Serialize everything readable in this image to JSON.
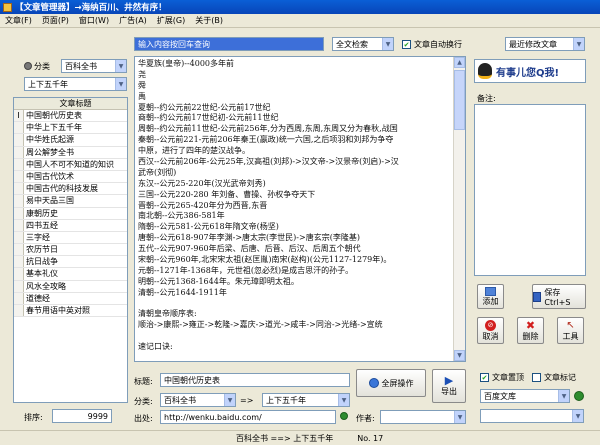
{
  "window": {
    "title": "【文章管理器】→海纳百川、井然有序！"
  },
  "menu": [
    "文章(F)",
    "页面(P)",
    "窗口(W)",
    "广告(A)",
    "扩展(G)",
    "关于(B)"
  ],
  "search": {
    "value": "输入内容按回车查询",
    "mode": "全文检索",
    "auto_wrap_label": "文章自动换行",
    "auto_wrap_checked": true,
    "sort": "最近修改文章"
  },
  "left": {
    "category_label": "分类",
    "category_value": "百科全书",
    "subcategory_value": "上下五千年",
    "list_header": "文章标题",
    "items": [
      "中国朝代历史表",
      "中华上下五千年",
      "中华姓氏起源",
      "周公解梦全书",
      "中国人不可不知道的知识",
      "中国古代饮术",
      "中国古代的科技发展",
      "易中天品三国",
      "康朝历史",
      "四书五经",
      "三字经",
      "农历节日",
      "抗日战争",
      "基本礼仪",
      "风水全攻略",
      "道德经",
      "春节用语中英对照"
    ],
    "selected_index": 0
  },
  "editor": {
    "lines": [
      "华夏族(皇帝)--4000多年前",
      "尧",
      "舜",
      "禹",
      "夏朝--约公元前22世纪-公元前17世纪",
      "商朝--约公元前17世纪初-公元前11世纪",
      "周朝--约公元前11世纪-公元前256年,分为西周,东周,东周又分为春秋,战国",
      "秦朝--公元前221-元前206年秦王(嬴政)统一六国,之后项羽和刘邦为争夺",
      "中原，进行了四年的楚汉战争。",
      "西汉--公元前206年-公元25年,汉高祖(刘邦)->汉文帝->汉景帝(刘启)->汉",
      "武帝(刘彻)",
      "东汉--公元25-220年(汉光武帝刘秀)",
      "三国--公元220-280 年刘备、曹操、孙权争夺天下",
      "晋朝--公元265-420年分为西晋,东晋",
      "南北朝--公元386-581年",
      "隋朝--公元581-公元618年隋文帝(杨坚)",
      "唐朝--公元618-907年李渊->唐太宗(李世民)->唐玄宗(李隆基)",
      "五代--公元907-960年后梁、后唐、后晋、后汉、后周五个朝代",
      "宋朝--公元960年,北宋宋太祖(赵匡胤)南宋(赵构)(公元1127-1279年)。",
      "元朝--1271年-1368年，元世祖(忽必烈)是成吉思汗的孙子。",
      "明朝--公元1368-1644年。朱元璋即明太祖。",
      "清朝--公元1644-1911年",
      "",
      "清朝皇帝顺序表:",
      "顺治->康熙->雍正->乾隆->嘉庆->道光->咸丰->同治->光绪->宣统",
      "",
      "速记口诀:"
    ]
  },
  "form": {
    "title_label": "标题:",
    "title_value": "中国朝代历史表",
    "category_label": "分类:",
    "category_value": "百科全书",
    "arrow": "=>",
    "subcategory_value": "上下五千年",
    "source_label": "出处:",
    "source_value": "http://wenku.baidu.com/",
    "author_label": "作者:",
    "author_value": "",
    "sort_label": "排序:",
    "sort_value": "9999",
    "fullscreen_label": "全屏操作",
    "export_label": "导出"
  },
  "right": {
    "banner": "有事儿您Q我!",
    "note_label": "备注:",
    "note_value": "",
    "buttons": {
      "add": "添加",
      "save": "保存 Ctrl+S",
      "cancel": "取消",
      "delete": "删除",
      "tools": "工具"
    },
    "pin_label": "文章置顶",
    "pin_checked": true,
    "mark_label": "文章标记",
    "mark_checked": false,
    "search_engine": "百度文库",
    "extra_value": ""
  },
  "statusbar": {
    "path": "百科全书 ==> 上下五千年",
    "count": "No. 17"
  },
  "colors": {
    "title_blue": "#0845b8",
    "accent_red": "#d21f1f",
    "accent_green": "#21a121"
  }
}
